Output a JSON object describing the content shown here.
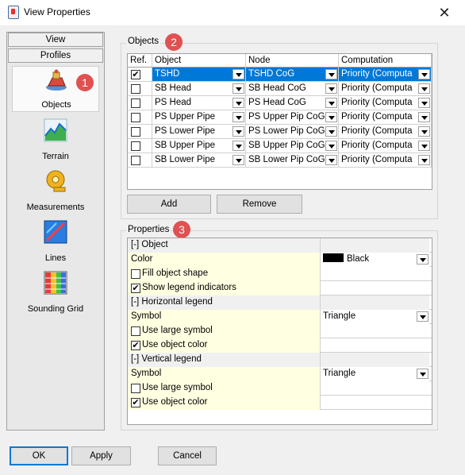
{
  "window": {
    "title": "View Properties",
    "close_glyph": "✕"
  },
  "left_panel": {
    "tabs": [
      "View",
      "Profiles"
    ],
    "items": [
      {
        "label": "Objects",
        "icon": "objects-icon"
      },
      {
        "label": "Terrain",
        "icon": "terrain-icon"
      },
      {
        "label": "Measurements",
        "icon": "measurements-icon"
      },
      {
        "label": "Lines",
        "icon": "lines-icon"
      },
      {
        "label": "Sounding Grid",
        "icon": "sounding-grid-icon"
      }
    ]
  },
  "badges": [
    "1",
    "2",
    "3"
  ],
  "objects": {
    "legend": "Objects",
    "columns": [
      "Ref.",
      "Object",
      "Node",
      "Computation"
    ],
    "rows": [
      {
        "ref": "✔",
        "object": "TSHD",
        "node": "TSHD CoG",
        "computation": "Priority (Computa"
      },
      {
        "ref": "",
        "object": "SB Head",
        "node": "SB Head CoG",
        "computation": "Priority (Computa"
      },
      {
        "ref": "",
        "object": "PS Head",
        "node": "PS Head CoG",
        "computation": "Priority (Computa"
      },
      {
        "ref": "",
        "object": "PS Upper Pipe",
        "node": "PS Upper Pip CoG",
        "computation": "Priority (Computa"
      },
      {
        "ref": "",
        "object": "PS Lower Pipe",
        "node": "PS Lower Pip CoG",
        "computation": "Priority (Computa"
      },
      {
        "ref": "",
        "object": "SB Upper Pipe",
        "node": "SB Upper Pip CoG",
        "computation": "Priority (Computa"
      },
      {
        "ref": "",
        "object": "SB Lower Pipe",
        "node": "SB Lower Pip CoG",
        "computation": "Priority (Computa"
      }
    ],
    "add_label": "Add",
    "remove_label": "Remove"
  },
  "properties": {
    "legend": "Properties",
    "rows": [
      {
        "type": "category",
        "name": "[-] Object"
      },
      {
        "type": "value",
        "name": "Color",
        "value": "Black",
        "swatch": "#000000",
        "dropdown": true
      },
      {
        "type": "check",
        "name": "Fill object shape",
        "checked": ""
      },
      {
        "type": "check",
        "name": "Show legend indicators",
        "checked": "✔"
      },
      {
        "type": "category",
        "name": "[-] Horizontal legend"
      },
      {
        "type": "value",
        "name": "Symbol",
        "value": "Triangle",
        "dropdown": true
      },
      {
        "type": "check",
        "name": "Use large symbol",
        "checked": ""
      },
      {
        "type": "check",
        "name": "Use object color",
        "checked": "✔"
      },
      {
        "type": "category",
        "name": "[-] Vertical legend"
      },
      {
        "type": "value",
        "name": "Symbol",
        "value": "Triangle",
        "dropdown": true
      },
      {
        "type": "check",
        "name": "Use large symbol",
        "checked": ""
      },
      {
        "type": "check",
        "name": "Use object color",
        "checked": "✔"
      }
    ]
  },
  "footer": {
    "ok_label": "OK",
    "apply_label": "Apply",
    "cancel_label": "Cancel"
  },
  "colors": {
    "accent": "#0078d7",
    "badge": "#e05152",
    "property_bg": "#ffffe1"
  }
}
